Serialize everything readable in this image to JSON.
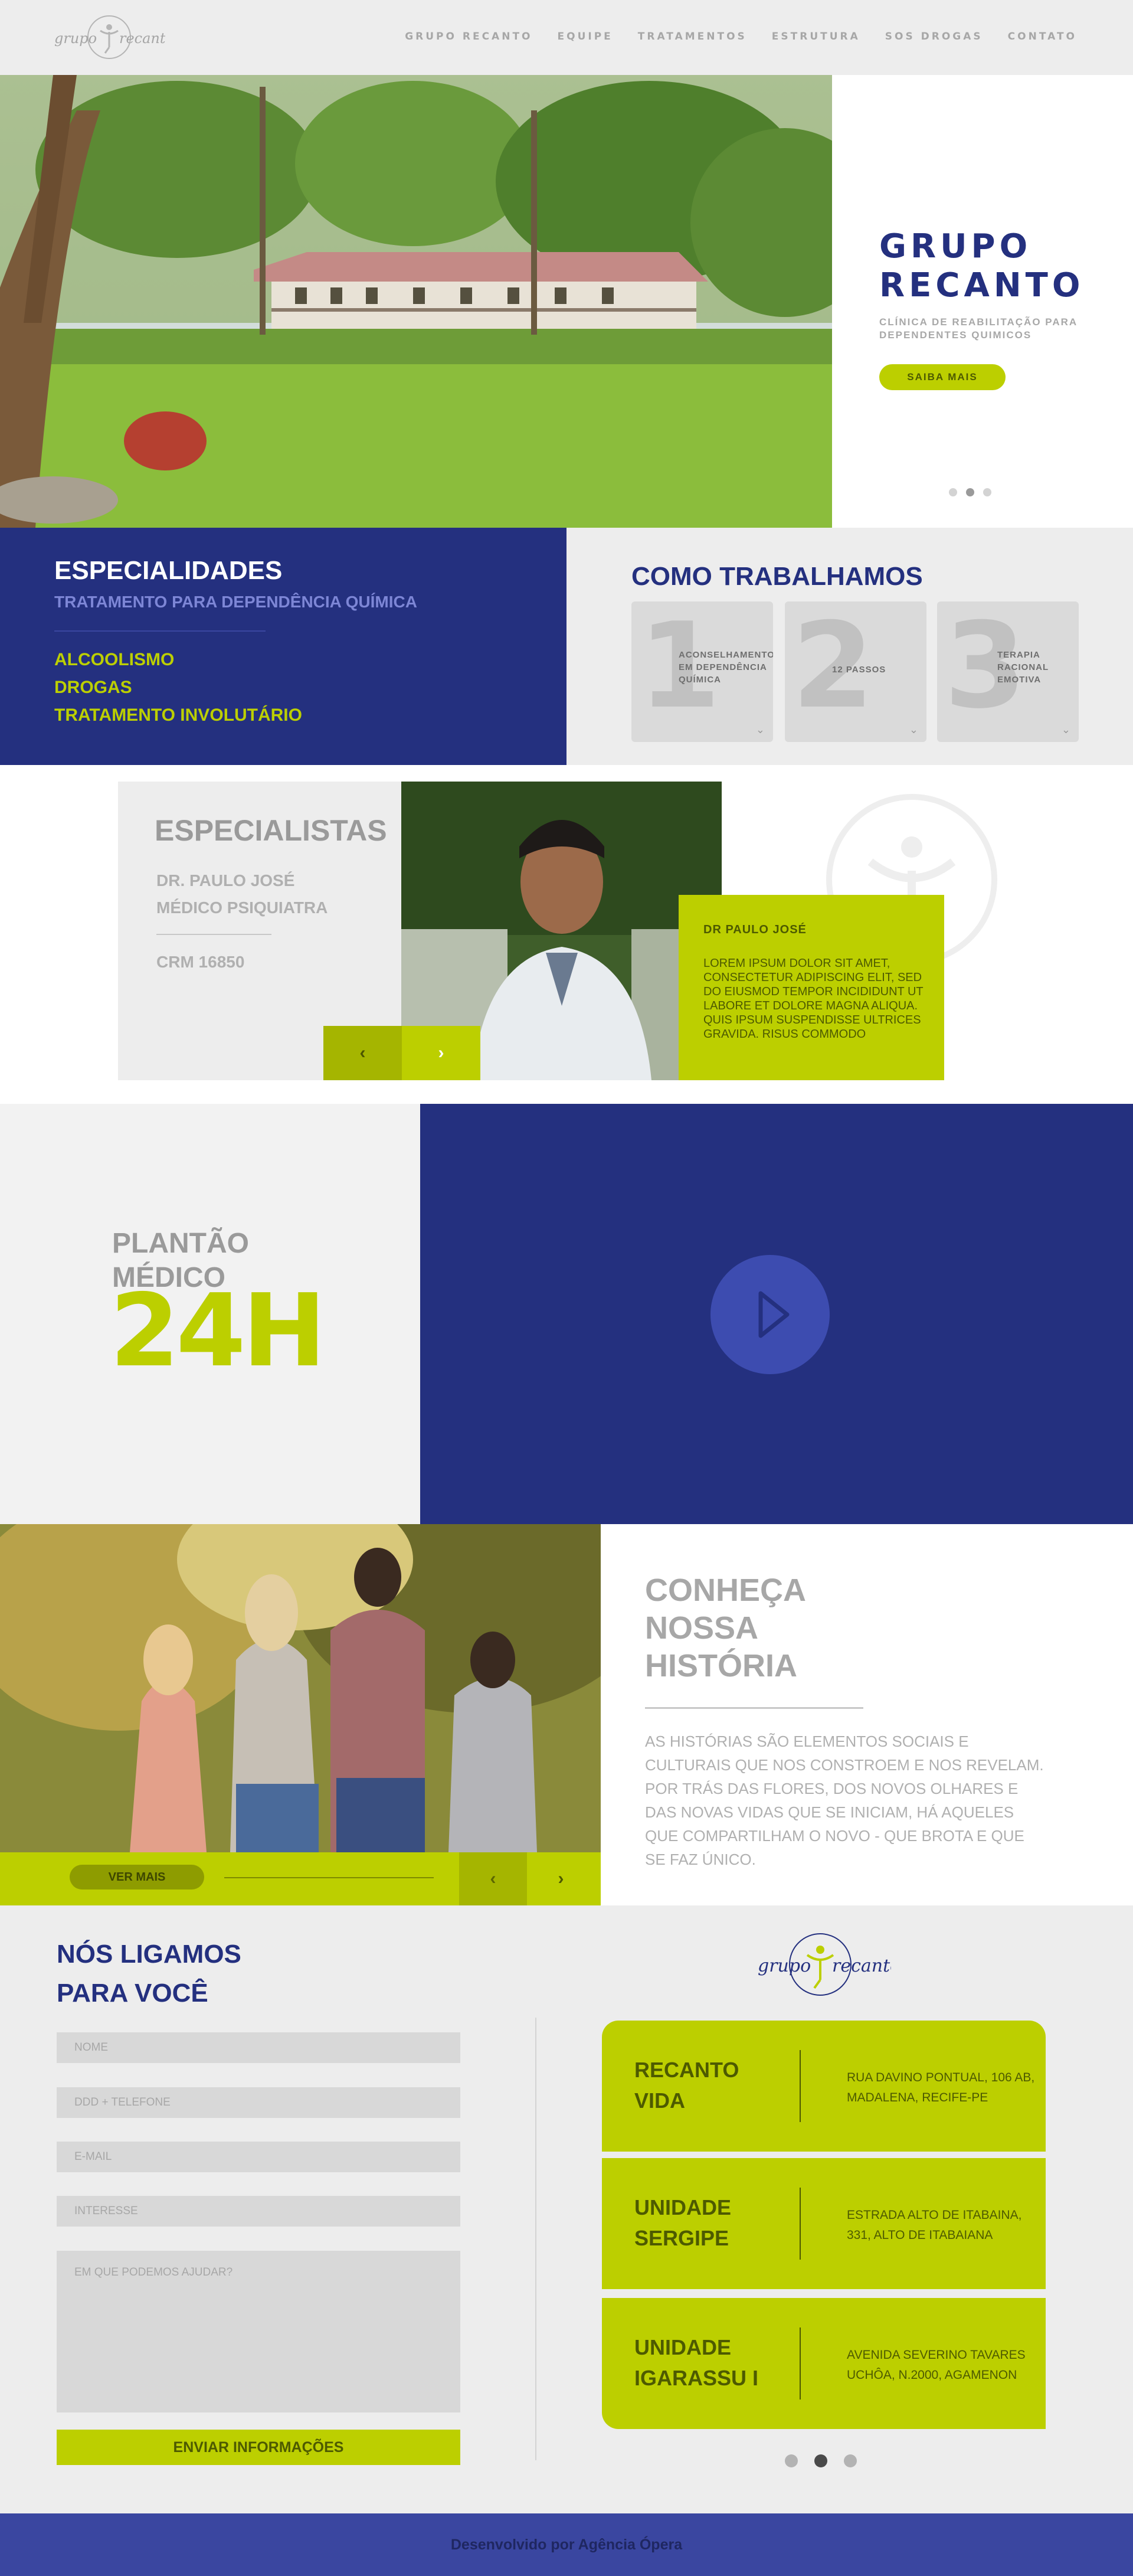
{
  "header": {
    "logo_text_1": "grupo",
    "logo_text_2": "recanto",
    "nav": [
      "GRUPO RECANTO",
      "EQUIPE",
      "TRATAMENTOS",
      "ESTRUTURA",
      "SOS DROGAS",
      "CONTATO"
    ]
  },
  "hero": {
    "title": "GRUPO RECANTO",
    "subtitle": "CLÍNICA DE REABILITAÇÃO PARA DEPENDENTES QUIMICOS",
    "button": "SAIBA MAIS",
    "active_slide": 2,
    "slide_count": 3
  },
  "especialidades": {
    "title": "ESPECIALIDADES",
    "subtitle": "TRATAMENTO PARA DEPENDÊNCIA QUÍMICA",
    "items": [
      "ALCOOLISMO",
      "DROGAS",
      "TRATAMENTO INVOLUTÁRIO"
    ]
  },
  "como": {
    "title": "COMO TRABALHAMOS",
    "steps": [
      {
        "num": "1",
        "label": "ACONSELHAMENTO EM DEPENDÊNCIA QUÍMICA"
      },
      {
        "num": "2",
        "label": "12 PASSOS"
      },
      {
        "num": "3",
        "label": "TERAPIA RACIONAL EMOTIVA"
      }
    ]
  },
  "especialistas": {
    "title": "ESPECIALISTAS",
    "name_line_1": "DR. PAULO JOSÉ",
    "name_line_2": "MÉDICO PSIQUIATRA",
    "crm": "CRM 16850",
    "card_name": "DR PAULO JOSÉ",
    "bio": "LOREM IPSUM DOLOR SIT AMET, CONSECTETUR ADIPISCING ELIT, SED DO EIUSMOD TEMPOR INCIDIDUNT UT LABORE ET DOLORE MAGNA ALIQUA. QUIS IPSUM SUSPENDISSE ULTRICES GRAVIDA. RISUS COMMODO"
  },
  "plantao": {
    "line_1": "PLANTÃO",
    "line_2": "MÉDICO",
    "big": "24H"
  },
  "historia": {
    "title": "CONHEÇA NOSSA HISTÓRIA",
    "text": "AS HISTÓRIAS SÃO ELEMENTOS SOCIAIS E CULTURAIS QUE NOS CONSTROEM E NOS REVELAM. POR TRÁS DAS FLORES, DOS NOVOS OLHARES E DAS NOVAS VIDAS QUE SE INICIAM, HÁ AQUELES QUE COMPARTILHAM O NOVO - QUE BROTA E QUE SE FAZ ÚNICO.",
    "button": "VER MAIS"
  },
  "contato": {
    "title": "NÓS LIGAMOS PARA VOCÊ",
    "fields": {
      "nome": "NOME",
      "telefone": "DDD + TELEFONE",
      "email": "E-MAIL",
      "interesse": "INTERESSE",
      "mensagem": "EM QUE PODEMOS AJUDAR?"
    },
    "button": "ENVIAR INFORMAÇÕES",
    "units": [
      {
        "name": "RECANTO VIDA",
        "address": "RUA DAVINO PONTUAL, 106 AB, MADALENA, RECIFE-PE"
      },
      {
        "name": "UNIDADE SERGIPE",
        "address": "ESTRADA ALTO DE ITABAINA, 331, ALTO DE ITABAIANA"
      },
      {
        "name": "UNIDADE IGARASSU I",
        "address": "AVENIDA SEVERINO TAVARES UCHÔA, N.2000, AGAMENON"
      }
    ],
    "active_slide": 2,
    "slide_count": 3
  },
  "footer": {
    "text": "Desenvolvido por Agência Ópera"
  },
  "colors": {
    "navy": "#24307f",
    "lime": "#bccf00",
    "grey_bg": "#ededed",
    "footer": "#3a46a0"
  }
}
